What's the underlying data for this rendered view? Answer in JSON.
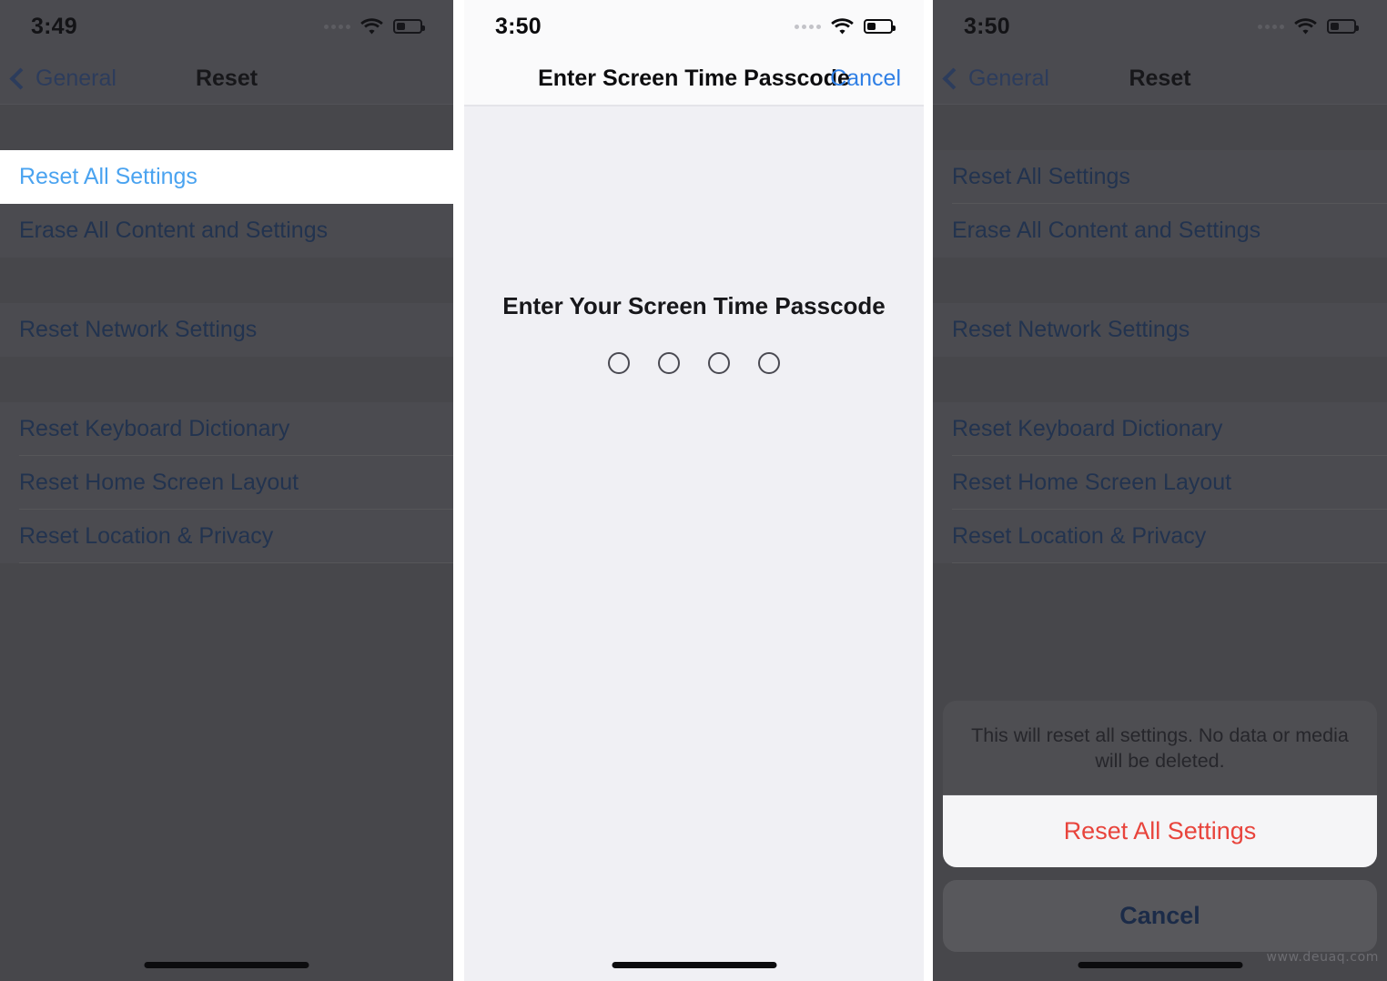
{
  "panels": [
    {
      "id": "panel-1-reset-list",
      "status_bar": {
        "time": "3:49",
        "signal_icon": "cellular-dots-icon",
        "wifi_icon": "wifi-icon",
        "battery_icon": "battery-low-icon"
      },
      "nav": {
        "back_label": "General",
        "back_icon": "chevron-left-icon",
        "title": "Reset"
      },
      "list": {
        "group_a": [
          {
            "label": "Reset All Settings",
            "highlighted": true
          },
          {
            "label": "Erase All Content and Settings",
            "highlighted": false
          }
        ],
        "group_b": [
          {
            "label": "Reset Network Settings",
            "highlighted": false
          }
        ],
        "group_c": [
          {
            "label": "Reset Keyboard Dictionary",
            "highlighted": false
          },
          {
            "label": "Reset Home Screen Layout",
            "highlighted": false
          },
          {
            "label": "Reset Location & Privacy",
            "highlighted": false
          }
        ]
      },
      "home_indicator": "home-indicator"
    },
    {
      "id": "panel-2-passcode",
      "status_bar": {
        "time": "3:50",
        "signal_icon": "cellular-dots-icon",
        "wifi_icon": "wifi-icon",
        "battery_icon": "battery-low-icon"
      },
      "nav": {
        "title": "Enter Screen Time Passcode",
        "cancel_label": "Cancel"
      },
      "prompt": "Enter Your Screen Time Passcode",
      "passcode_dots": 4,
      "home_indicator": "home-indicator"
    },
    {
      "id": "panel-3-action-sheet",
      "status_bar": {
        "time": "3:50",
        "signal_icon": "cellular-dots-icon",
        "wifi_icon": "wifi-icon",
        "battery_icon": "battery-low-icon"
      },
      "nav": {
        "back_label": "General",
        "back_icon": "chevron-left-icon",
        "title": "Reset"
      },
      "list": {
        "group_a": [
          {
            "label": "Reset All Settings",
            "highlighted": false
          },
          {
            "label": "Erase All Content and Settings",
            "highlighted": false
          }
        ],
        "group_b": [
          {
            "label": "Reset Network Settings",
            "highlighted": false
          }
        ],
        "group_c": [
          {
            "label": "Reset Keyboard Dictionary",
            "highlighted": false
          },
          {
            "label": "Reset Home Screen Layout",
            "highlighted": false
          },
          {
            "label": "Reset Location & Privacy",
            "highlighted": false
          }
        ]
      },
      "action_sheet": {
        "message": "This will reset all settings. No data or media will be deleted.",
        "destructive_label": "Reset All Settings",
        "cancel_label": "Cancel"
      },
      "home_indicator": "home-indicator"
    }
  ],
  "watermark": "www.deuaq.com",
  "colors": {
    "ios_blue": "#2f7fe5",
    "destructive_red": "#e8443c",
    "dim_background": "#47474b",
    "light_background": "#f0f0f4",
    "highlight_white": "#ffffff"
  }
}
